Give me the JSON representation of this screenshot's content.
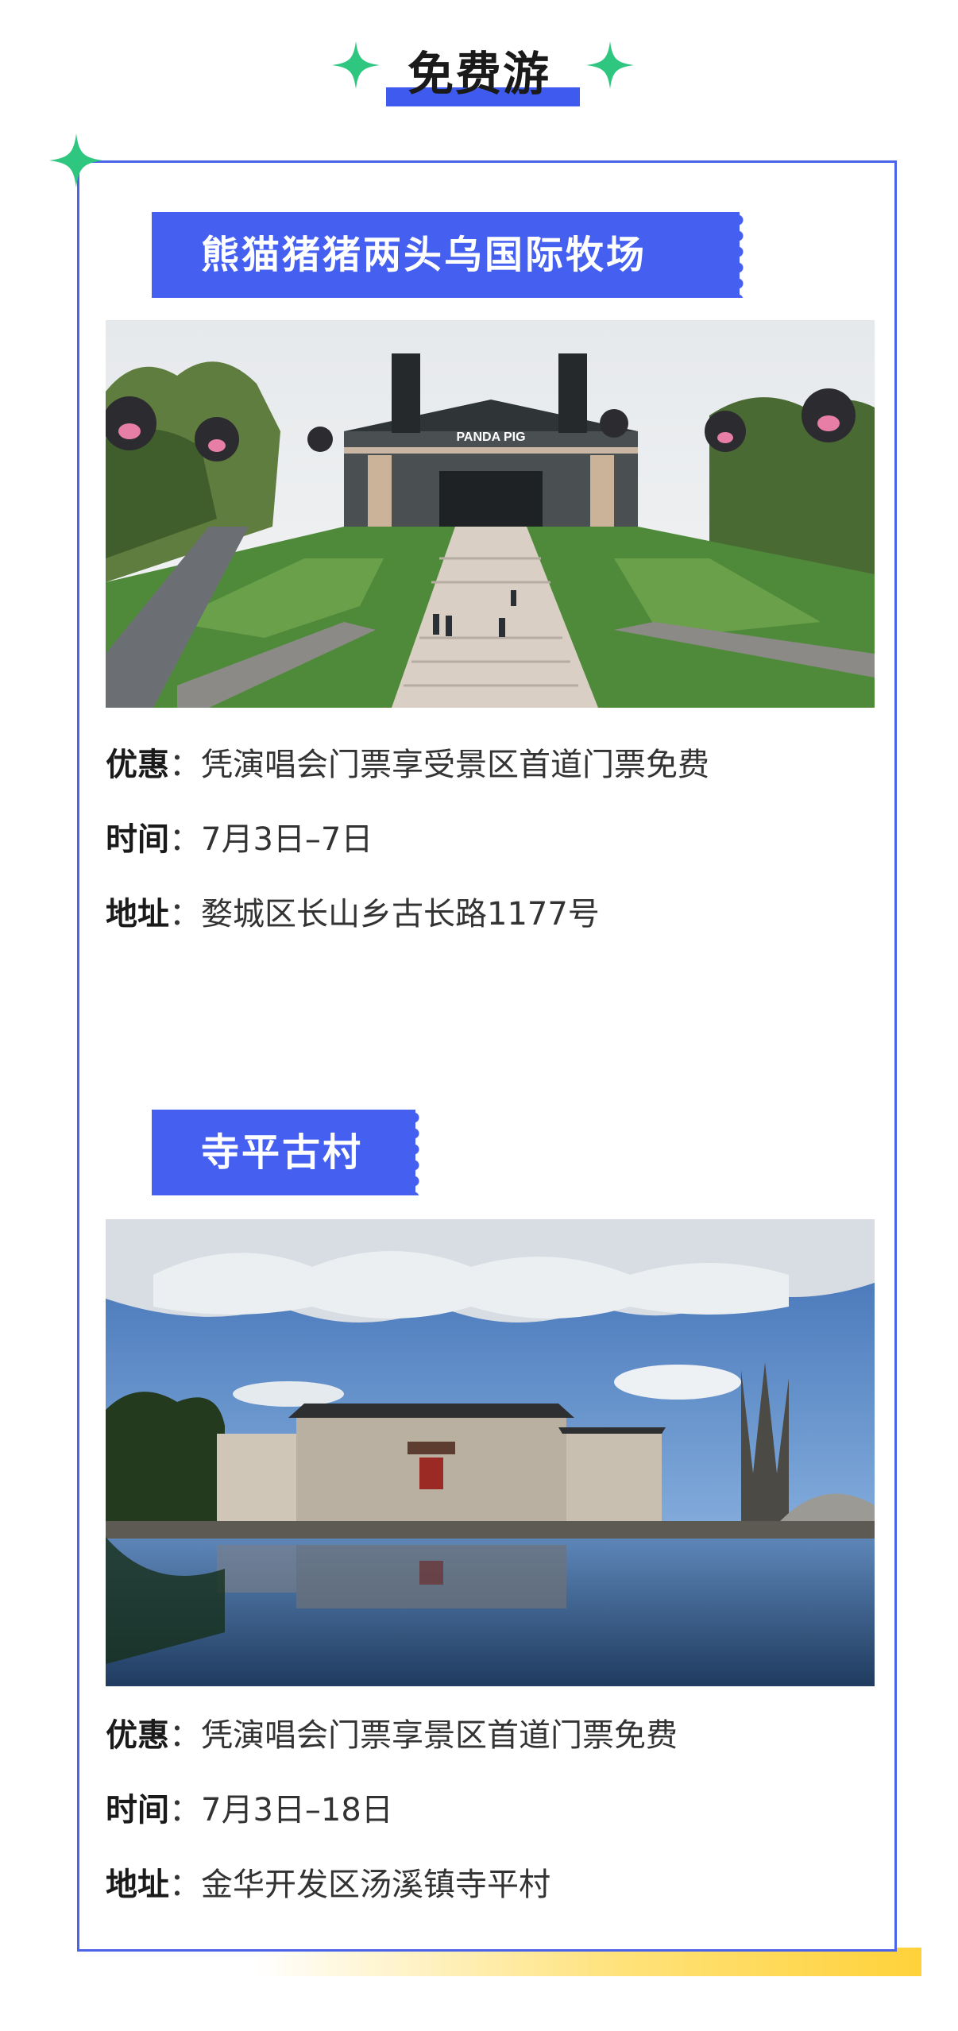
{
  "header": {
    "title": "免费游"
  },
  "colors": {
    "accent_blue": "#4560f0",
    "sparkle_green": "#2fc780",
    "shadow_yellow": "#ffd23a"
  },
  "sections": [
    {
      "title": "熊猫猪猪两头乌国际牧场",
      "photo_sign": "PANDA PIG",
      "rows": [
        {
          "key": "优惠",
          "value": "凭演唱会门票享受景区首道门票免费"
        },
        {
          "key": "时间",
          "value": "7月3日–7日"
        },
        {
          "key": "地址",
          "value": "婺城区长山乡古长路1177号"
        }
      ]
    },
    {
      "title": "寺平古村",
      "rows": [
        {
          "key": "优惠",
          "value": "凭演唱会门票享景区首道门票免费"
        },
        {
          "key": "时间",
          "value": "7月3日–18日"
        },
        {
          "key": "地址",
          "value": "金华开发区汤溪镇寺平村"
        }
      ]
    }
  ],
  "separator": "："
}
